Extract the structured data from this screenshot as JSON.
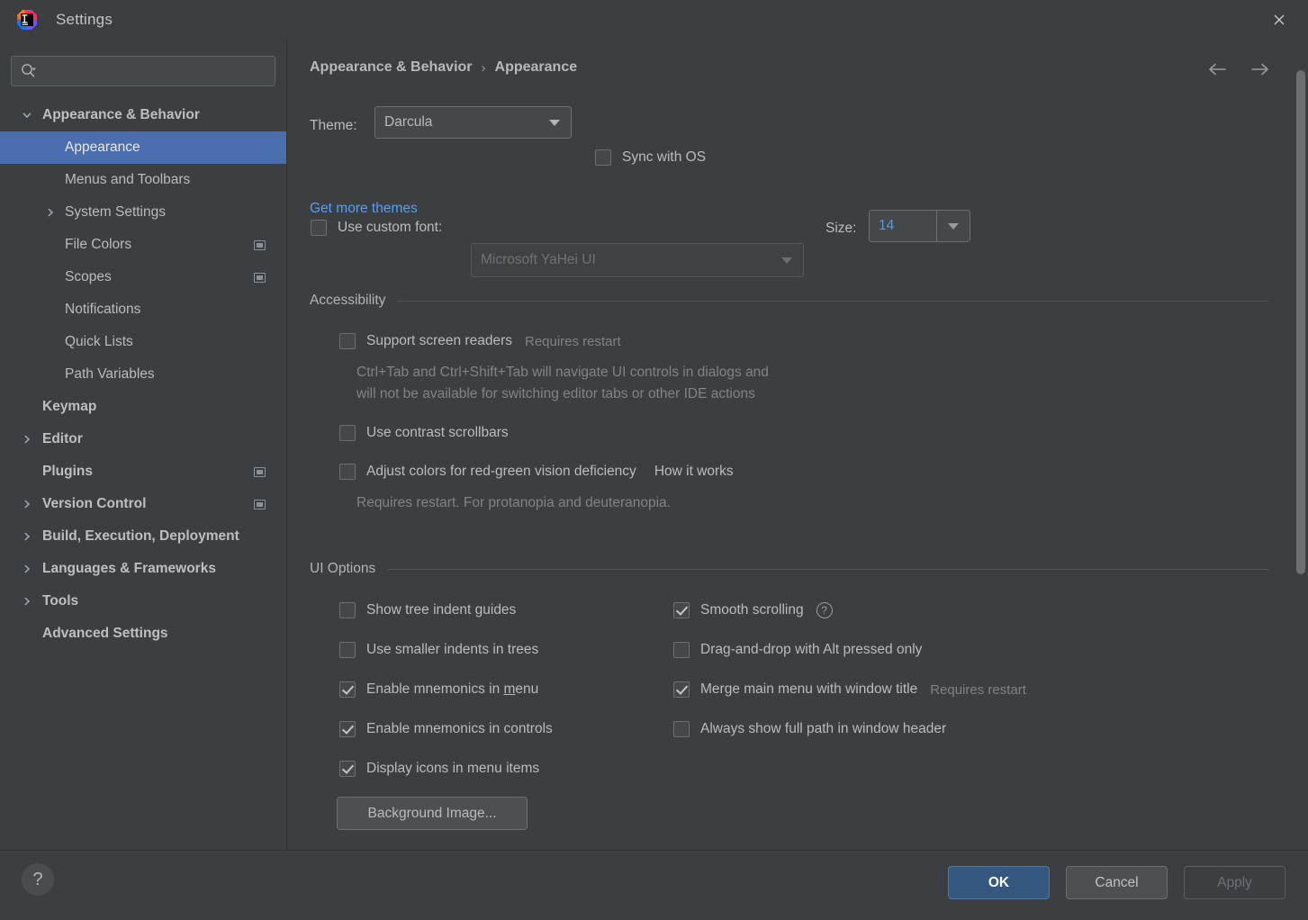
{
  "window": {
    "title": "Settings",
    "logo_icon": "intellij-idea-logo",
    "close_icon": "close-icon"
  },
  "sidebar": {
    "search": {
      "placeholder": "",
      "value": "",
      "icon": "search-icon",
      "dropdown_icon": "chevron-down-icon"
    },
    "items": [
      {
        "label": "Appearance & Behavior",
        "indent": 28,
        "twisty": "expanded",
        "bold": true,
        "selected": false,
        "config_icon": false
      },
      {
        "label": "Appearance",
        "indent": 72,
        "twisty": "none",
        "bold": false,
        "selected": true,
        "config_icon": false
      },
      {
        "label": "Menus and Toolbars",
        "indent": 72,
        "twisty": "none",
        "bold": false,
        "selected": false,
        "config_icon": false
      },
      {
        "label": "System Settings",
        "indent": 72,
        "twisty": "collapsed",
        "bold": false,
        "selected": false,
        "config_icon": false
      },
      {
        "label": "File Colors",
        "indent": 72,
        "twisty": "none",
        "bold": false,
        "selected": false,
        "config_icon": true
      },
      {
        "label": "Scopes",
        "indent": 72,
        "twisty": "none",
        "bold": false,
        "selected": false,
        "config_icon": true
      },
      {
        "label": "Notifications",
        "indent": 72,
        "twisty": "none",
        "bold": false,
        "selected": false,
        "config_icon": false
      },
      {
        "label": "Quick Lists",
        "indent": 72,
        "twisty": "none",
        "bold": false,
        "selected": false,
        "config_icon": false
      },
      {
        "label": "Path Variables",
        "indent": 72,
        "twisty": "none",
        "bold": false,
        "selected": false,
        "config_icon": false
      },
      {
        "label": "Keymap",
        "indent": 46,
        "twisty": "none",
        "bold": true,
        "selected": false,
        "config_icon": false
      },
      {
        "label": "Editor",
        "indent": 46,
        "twisty": "collapsed",
        "bold": true,
        "selected": false,
        "config_icon": false
      },
      {
        "label": "Plugins",
        "indent": 46,
        "twisty": "none",
        "bold": true,
        "selected": false,
        "config_icon": true
      },
      {
        "label": "Version Control",
        "indent": 46,
        "twisty": "collapsed",
        "bold": true,
        "selected": false,
        "config_icon": true
      },
      {
        "label": "Build, Execution, Deployment",
        "indent": 46,
        "twisty": "collapsed",
        "bold": true,
        "selected": false,
        "config_icon": false
      },
      {
        "label": "Languages & Frameworks",
        "indent": 46,
        "twisty": "collapsed",
        "bold": true,
        "selected": false,
        "config_icon": false
      },
      {
        "label": "Tools",
        "indent": 46,
        "twisty": "collapsed",
        "bold": true,
        "selected": false,
        "config_icon": false
      },
      {
        "label": "Advanced Settings",
        "indent": 46,
        "twisty": "none",
        "bold": true,
        "selected": false,
        "config_icon": false
      }
    ]
  },
  "header": {
    "breadcrumb_root": "Appearance & Behavior",
    "breadcrumb_sep": "›",
    "breadcrumb_leaf": "Appearance",
    "back_icon": "arrow-left-icon",
    "forward_icon": "arrow-right-icon"
  },
  "theme": {
    "label": "Theme:",
    "value": "Darcula",
    "sync_label": "Sync with OS",
    "sync_checked": false,
    "get_more_link": "Get more themes"
  },
  "font": {
    "use_custom_label": "Use custom font:",
    "use_custom_checked": false,
    "font_value": "Microsoft YaHei UI",
    "size_label": "Size:",
    "size_value": "14"
  },
  "accessibility": {
    "group_title": "Accessibility",
    "screen_readers_label": "Support screen readers",
    "screen_readers_checked": false,
    "screen_readers_note": "Requires restart",
    "screen_readers_desc_1": "Ctrl+Tab and Ctrl+Shift+Tab will navigate UI controls in dialogs and",
    "screen_readers_desc_2": "will not be available for switching editor tabs or other IDE actions",
    "contrast_scrollbars_label": "Use contrast scrollbars",
    "contrast_scrollbars_checked": false,
    "adjust_colors_label": "Adjust colors for red-green vision deficiency",
    "adjust_colors_checked": false,
    "how_it_works_link": "How it works",
    "adjust_colors_desc": "Requires restart. For protanopia and deuteranopia."
  },
  "ui_options": {
    "group_title": "UI Options",
    "left": [
      {
        "label": "Show tree indent guides",
        "checked": false
      },
      {
        "label": "Use smaller indents in trees",
        "checked": false
      },
      {
        "label": "Enable mnemonics in ",
        "mnemonic": "m",
        "label_tail": "enu",
        "checked": true
      },
      {
        "label": "Enable mnemonics in controls",
        "checked": true
      },
      {
        "label": "Display icons in menu items",
        "checked": true
      }
    ],
    "right": [
      {
        "label": "Smooth scrolling",
        "checked": true,
        "help": true
      },
      {
        "label": "Drag-and-drop with Alt pressed only",
        "checked": false
      },
      {
        "label": "Merge main menu with window title",
        "checked": true,
        "note": "Requires restart"
      },
      {
        "label": "Always show full path in window header",
        "checked": false
      }
    ],
    "background_image_button": "Background Image..."
  },
  "footer": {
    "help_label": "?",
    "ok_label": "OK",
    "cancel_label": "Cancel",
    "apply_label": "Apply"
  },
  "colors": {
    "background": "#3c3f41",
    "selection": "#4b6eaf",
    "link": "#589df6",
    "primary_button": "#365880",
    "text": "#bbbbbb",
    "muted_text": "#808486"
  }
}
